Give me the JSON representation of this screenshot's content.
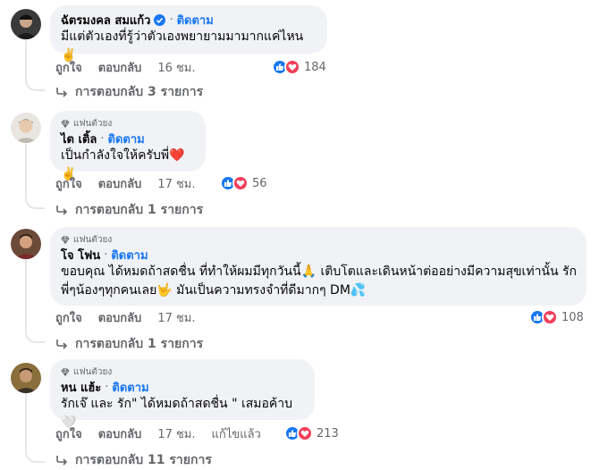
{
  "comments": [
    {
      "badge": "",
      "name": "ฉัตรมงคล สมแก้ว",
      "verified": true,
      "follow": "ติดตาม",
      "text": "มีแต่ตัวเองที่รู้ว่าตัวเองพยายามมามากแค่ไหน ✌️",
      "like": "ถูกใจ",
      "reply": "ตอบกลับ",
      "time": "16 ชม.",
      "edited": "",
      "reaction_count": "184",
      "replies": "การตอบกลับ 3 รายการ"
    },
    {
      "badge": "แฟนตัวยง",
      "name": "ไต เติ้ล",
      "verified": false,
      "follow": "ติดตาม",
      "text": "เป็นกำลังใจให้ครับพี่❤️✌️",
      "like": "ถูกใจ",
      "reply": "ตอบกลับ",
      "time": "17 ชม.",
      "edited": "",
      "reaction_count": "56",
      "replies": "การตอบกลับ 1 รายการ"
    },
    {
      "badge": "แฟนตัวยง",
      "name": "โจ โฟน",
      "verified": false,
      "follow": "ติดตาม",
      "text_line1": "ขอบคุณ ได้หมดถ้าสดชื่น ที่ทำให้ผมมีทุกวันนี้🙏 เติบโตและเดินหน้าต่ออย่างมีความสุขเท่านั้น รัก",
      "text_line2": "พี่ๆน้องๆทุกคนเลย🤟 มันเป็นความทรงจำที่ดีมากๆ DM💦",
      "like": "ถูกใจ",
      "reply": "ตอบกลับ",
      "time": "17 ชม.",
      "edited": "",
      "reaction_count": "108",
      "replies": "การตอบกลับ 1 รายการ"
    },
    {
      "badge": "แฟนตัวยง",
      "name": "หน แฮ้ะ",
      "verified": false,
      "follow": "ติดตาม",
      "text": "รักเจ๊ และ รัก\" ได้หมดถ้าสดชื่น \" เสมอค้าบ 🤍",
      "like": "ถูกใจ",
      "reply": "ตอบกลับ",
      "time": "17 ชม.",
      "edited": "แก้ไขแล้ว",
      "reaction_count": "213",
      "replies": "การตอบกลับ 11 รายการ"
    }
  ],
  "colors": {
    "accent": "#1877f2",
    "bubble": "#f0f2f5",
    "muted": "#65676b",
    "love": "#f33e58"
  }
}
